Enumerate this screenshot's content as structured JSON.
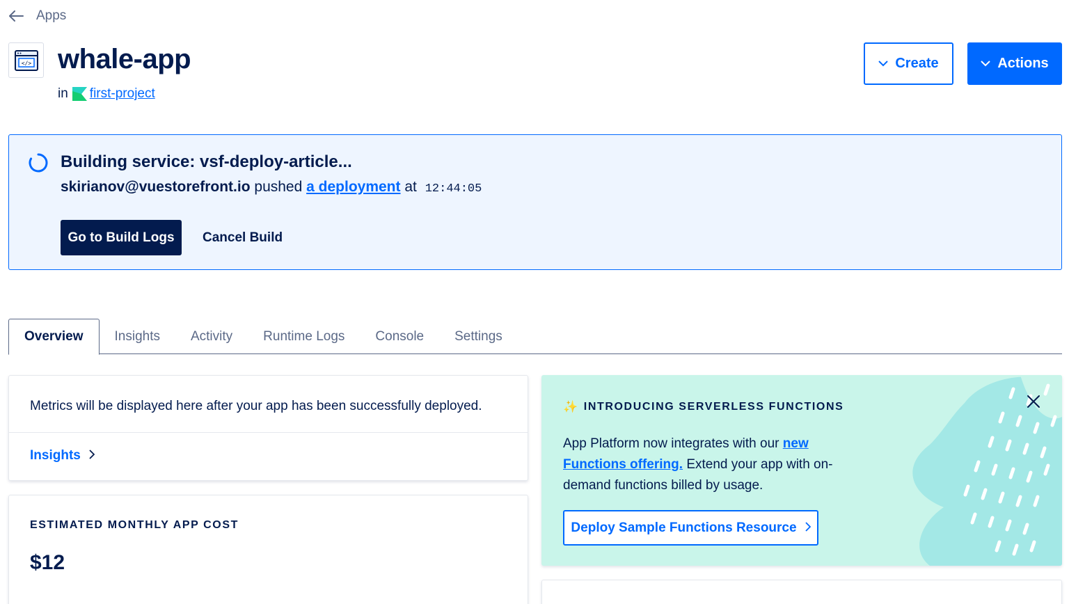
{
  "breadcrumb": {
    "back_icon": "arrow-left-icon",
    "label": "Apps"
  },
  "app": {
    "icon": "code-window-icon",
    "name": "whale-app",
    "in_label": "in",
    "project_icon": "project-flag-icon",
    "project_name": "first-project"
  },
  "header_actions": {
    "create_label": "Create",
    "actions_label": "Actions",
    "chevron_icon": "chevron-down-icon"
  },
  "build": {
    "status_icon": "spinner-icon",
    "title": "Building service: vsf-deploy-article...",
    "user": "skirianov@vuestorefront.io",
    "pushed_text": "pushed",
    "deployment_link": "a deployment",
    "at_text": "at",
    "time": "12:44:05",
    "logs_button": "Go to Build Logs",
    "cancel_button": "Cancel Build"
  },
  "tabs": [
    {
      "label": "Overview",
      "active": true
    },
    {
      "label": "Insights",
      "active": false
    },
    {
      "label": "Activity",
      "active": false
    },
    {
      "label": "Runtime Logs",
      "active": false
    },
    {
      "label": "Console",
      "active": false
    },
    {
      "label": "Settings",
      "active": false
    }
  ],
  "metrics_card": {
    "message": "Metrics will be displayed here after your app has been successfully deployed.",
    "link_label": "Insights",
    "link_icon": "chevron-right-icon"
  },
  "cost_card": {
    "label": "ESTIMATED MONTHLY APP COST",
    "value": "$12"
  },
  "promo": {
    "sparkle_icon": "sparkle-icon",
    "heading": "INTRODUCING SERVERLESS FUNCTIONS",
    "close_icon": "close-icon",
    "body_before": "App Platform now integrates with our ",
    "body_link": "new Functions offering.",
    "body_after": " Extend your app with on-demand functions billed by usage.",
    "button_label": "Deploy Sample Functions Resource",
    "button_icon": "chevron-right-icon"
  },
  "colors": {
    "brand_blue": "#0069ff",
    "navy": "#031b4e",
    "banner_bg": "#eef5ff",
    "promo_bg": "#c9f5ea",
    "muted_text": "#5b6987"
  }
}
